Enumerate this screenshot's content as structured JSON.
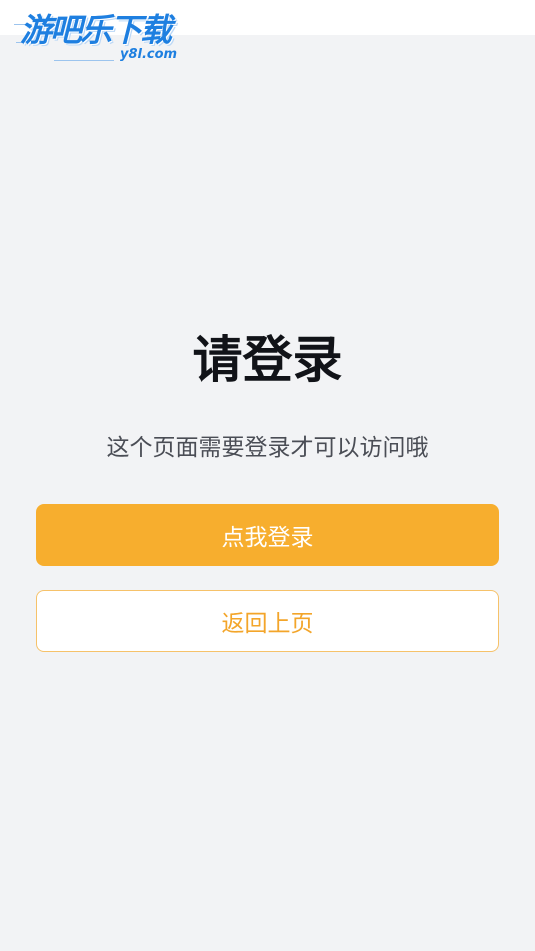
{
  "logo": {
    "main_text": "游吧乐下载",
    "sub_text": "y8l.com"
  },
  "page": {
    "title": "请登录",
    "message": "这个页面需要登录才可以访问哦"
  },
  "actions": {
    "login_label": "点我登录",
    "back_label": "返回上页"
  },
  "colors": {
    "background": "#f2f3f5",
    "accent": "#f7ae2e",
    "logo_blue": "#1e7fe0"
  }
}
